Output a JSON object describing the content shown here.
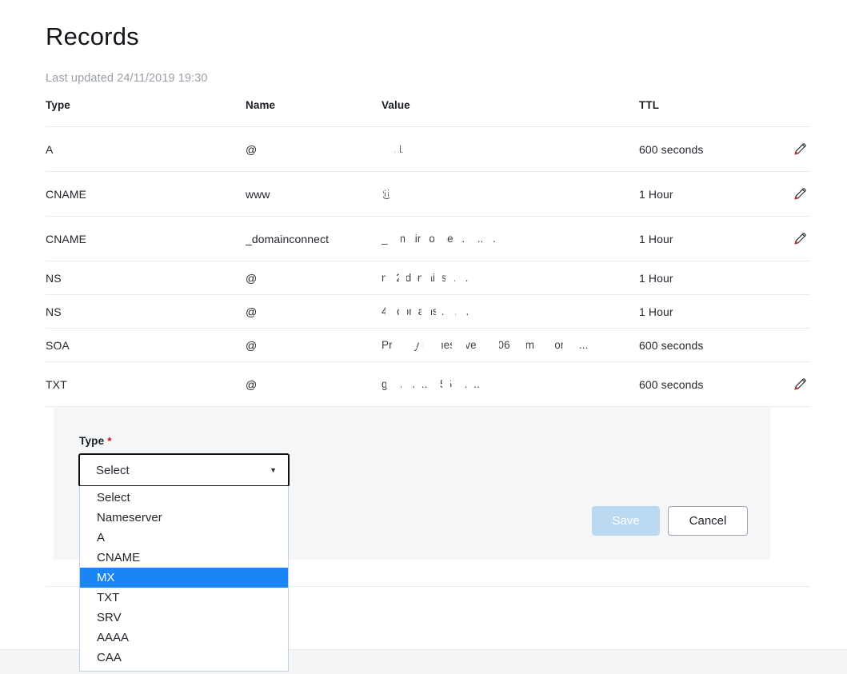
{
  "header": {
    "title": "Records",
    "last_updated": "Last updated 24/11/2019 19:30"
  },
  "table": {
    "columns": [
      "Type",
      "Name",
      "Value",
      "TTL"
    ],
    "rows": [
      {
        "type": "A",
        "name": "@",
        "value": ".    .          .1",
        "ttl": "600 seconds",
        "editable": true
      },
      {
        "type": "CNAME",
        "name": "www",
        "value": "@",
        "ttl": "1 Hour",
        "editable": true
      },
      {
        "type": "CNAME",
        "name": "_domainconnect",
        "value": "_domainconnect.  .......      .",
        "ttl": "1 Hour",
        "editable": true
      },
      {
        "type": "NS",
        "name": "@",
        "value": "ns/2 domains.  . . .",
        "ttl": "1 Hour",
        "editable": false
      },
      {
        "type": "NS",
        "name": "@",
        "value": "44 domains .  .  . . .",
        "ttl": "1 Hour",
        "editable": false
      },
      {
        "type": "SOA",
        "name": "@",
        "value": "Primary  nameserver: ns06.domaincont .  ...",
        "ttl": "600 seconds",
        "editable": false
      },
      {
        "type": "TXT",
        "name": "@",
        "value": "go.  .  . ..  ..    ..  55              ....      ...",
        "ttl": "600 seconds",
        "editable": true
      }
    ],
    "edit_icon": "pencil-icon"
  },
  "form": {
    "type_label": "Type",
    "required_marker": "*",
    "select": {
      "value": "Select",
      "caret_icon": "chevron-down-icon",
      "options": [
        "Select",
        "Nameserver",
        "A",
        "CNAME",
        "MX",
        "TXT",
        "SRV",
        "AAAA",
        "CAA"
      ],
      "highlighted_option": "MX",
      "highlight_color": "#1a85f5"
    },
    "save_label": "Save",
    "cancel_label": "Cancel",
    "save_disabled_color": "#bcd9f2",
    "panel_color": "#f4f6f8"
  }
}
